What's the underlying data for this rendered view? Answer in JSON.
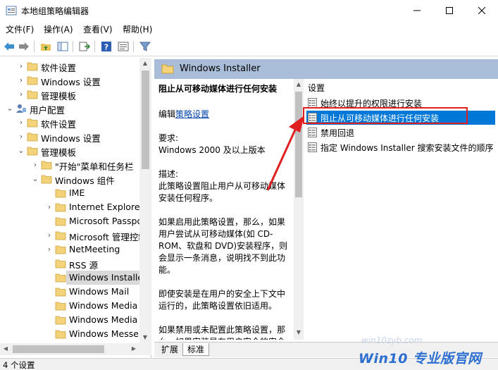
{
  "window": {
    "title": "本地组策略编辑器"
  },
  "menu": [
    "文件(F)",
    "操作(A)",
    "查看(V)",
    "帮助(H)"
  ],
  "tree": [
    {
      "label": "软件设置",
      "expander": ">",
      "level": 1
    },
    {
      "label": "Windows 设置",
      "expander": ">",
      "level": 1
    },
    {
      "label": "管理模板",
      "expander": ">",
      "level": 1
    },
    {
      "label": "用户配置",
      "expander": "v",
      "level": 0,
      "icon": "user"
    },
    {
      "label": "软件设置",
      "expander": ">",
      "level": 1
    },
    {
      "label": "Windows 设置",
      "expander": ">",
      "level": 1
    },
    {
      "label": "管理模板",
      "expander": "v",
      "level": 1
    },
    {
      "label": "\"开始\"菜单和任务栏",
      "expander": ">",
      "level": 2
    },
    {
      "label": "Windows 组件",
      "expander": "v",
      "level": 2
    },
    {
      "label": "IME",
      "expander": "",
      "level": 3
    },
    {
      "label": "Internet Explorer",
      "expander": ">",
      "level": 3
    },
    {
      "label": "Microsoft Passport",
      "expander": "",
      "level": 3
    },
    {
      "label": "Microsoft 管理控制台",
      "expander": ">",
      "level": 3
    },
    {
      "label": "NetMeeting",
      "expander": ">",
      "level": 3
    },
    {
      "label": "RSS 源",
      "expander": "",
      "level": 3
    },
    {
      "label": "Windows Installer",
      "expander": "",
      "level": 3,
      "selected": true
    },
    {
      "label": "Windows Mail",
      "expander": "",
      "level": 3
    },
    {
      "label": "Windows Media Center",
      "expander": "",
      "level": 3
    },
    {
      "label": "Windows Media Player",
      "expander": "",
      "level": 3
    },
    {
      "label": "Windows Messenger",
      "expander": "",
      "level": 3
    }
  ],
  "right": {
    "header": "Windows Installer",
    "desc": {
      "title": "阻止从可移动媒体进行任何安装",
      "edit_prefix": "编辑",
      "edit_link": "策略设置",
      "req_label": "要求:",
      "req_value": "Windows 2000 及以上版本",
      "desc_label": "描述:",
      "desc_lines": [
        "此策略设置阻止用户从可移动媒体",
        "安装任何程序。"
      ],
      "p2_lines": [
        "如果启用此策略设置，那么，如果",
        "用户尝试从可移动媒体(如 CD-",
        "ROM、软盘和 DVD)安装程序，则",
        "会显示一条消息，说明找不到此功",
        "能。"
      ],
      "p3_lines": [
        "即使安装是在用户的安全上下文中",
        "运行的，此策略设置依旧适用。"
      ],
      "p4_lines": [
        "如果禁用或未配置此策略设置，那",
        "么，如果安装是在用户安全的安全"
      ]
    },
    "list_header": "设置",
    "settings": [
      "始终以提升的权限进行安装",
      "阻止从可移动媒体进行任何安装",
      "禁用回退",
      "指定 Windows Installer 搜索安装文件的顺序"
    ],
    "selected_index": 1
  },
  "tabs": [
    "扩展",
    "标准"
  ],
  "status": "4 个设置",
  "watermark": {
    "url": "win10zyb.com",
    "logo": "Win10 专业版官网"
  },
  "colors": {
    "header_bg": "#a9bdd8",
    "selection": "#0078d7",
    "highlight_border": "#e02020",
    "arrow": "#e02020"
  }
}
